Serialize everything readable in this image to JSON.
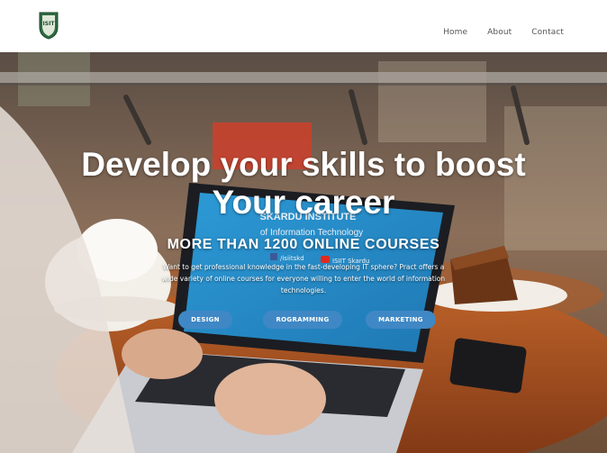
{
  "nav": {
    "logo_text": "ISIT",
    "links": [
      "Home",
      "About",
      "Contact"
    ]
  },
  "hero": {
    "headline_line1": "Develop your skills to boost",
    "headline_line2": "Your career",
    "subheadline": "MORE THAN 1200 ONLINE COURSES",
    "description": "Want to get professional knowledge in the fast-developing IT sphere? Pract offers a wide variety of online courses for everyone willing to enter the world of information technologies.",
    "buttons": [
      "DESIGN",
      "ROGRAMMING",
      "MARKETING"
    ],
    "laptop_screen": {
      "line1": "SKARDU INSTITUTE",
      "line2": "of Information Technology",
      "facebook": "/isiitskd",
      "youtube": "ISIIT Skardu"
    }
  },
  "colors": {
    "button_bg": "#3f88c5",
    "laptop_screen": "#2a8fc8",
    "table_wood": "#a8521f"
  }
}
